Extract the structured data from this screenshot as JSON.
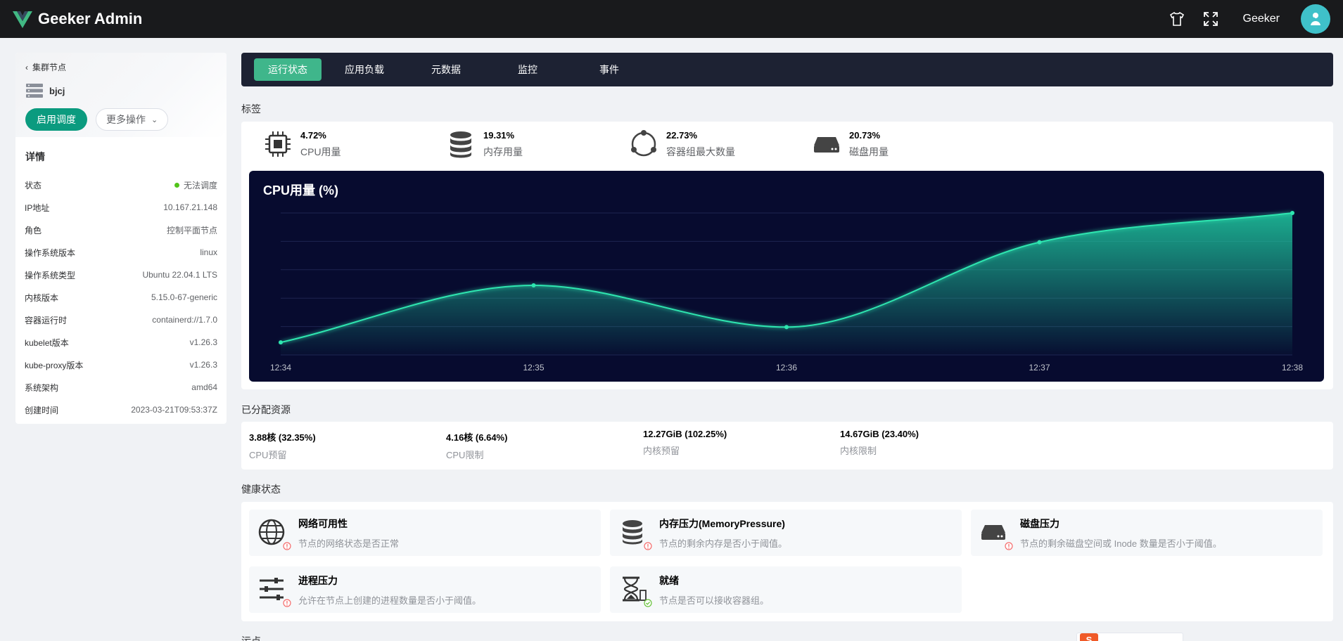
{
  "app": {
    "title": "Geeker Admin",
    "username": "Geeker"
  },
  "colors": {
    "primary": "#0b9b7f",
    "tab_active": "#3fb68b",
    "header_bg": "#191a1c",
    "tabs_bg": "#1d2233",
    "chart_bg": "#070b2f",
    "chart_line": "#2ee6b0"
  },
  "left": {
    "back_label": "集群节点",
    "node_name": "bjcj",
    "primary_button": "启用调度",
    "more_button": "更多操作",
    "details_title": "详情",
    "details": [
      {
        "key": "状态",
        "value": "无法调度",
        "status_dot": true
      },
      {
        "key": "IP地址",
        "value": "10.167.21.148"
      },
      {
        "key": "角色",
        "value": "控制平面节点"
      },
      {
        "key": "操作系统版本",
        "value": "linux"
      },
      {
        "key": "操作系统类型",
        "value": "Ubuntu 22.04.1 LTS"
      },
      {
        "key": "内核版本",
        "value": "5.15.0-67-generic"
      },
      {
        "key": "容器运行时",
        "value": "containerd://1.7.0"
      },
      {
        "key": "kubelet版本",
        "value": "v1.26.3"
      },
      {
        "key": "kube-proxy版本",
        "value": "v1.26.3"
      },
      {
        "key": "系统架构",
        "value": "amd64"
      },
      {
        "key": "创建时间",
        "value": "2023-03-21T09:53:37Z"
      }
    ]
  },
  "tabs": [
    {
      "label": "运行状态",
      "active": true
    },
    {
      "label": "应用负载"
    },
    {
      "label": "元数据"
    },
    {
      "label": "监控"
    },
    {
      "label": "事件"
    }
  ],
  "labels_section": {
    "title": "标签",
    "metrics": [
      {
        "value": "4.72%",
        "label": "CPU用量",
        "icon": "cpu-icon"
      },
      {
        "value": "19.31%",
        "label": "内存用量",
        "icon": "database-icon"
      },
      {
        "value": "22.73%",
        "label": "容器组最大数量",
        "icon": "pods-cycle-icon"
      },
      {
        "value": "20.73%",
        "label": "磁盘用量",
        "icon": "disk-icon"
      }
    ]
  },
  "chart_data": {
    "type": "area",
    "title": "CPU用量 (%)",
    "x": [
      "12:34",
      "12:35",
      "12:36",
      "12:37",
      "12:38"
    ],
    "series": [
      {
        "values": [
          0.9,
          5.0,
          2.0,
          8.1,
          10.2
        ]
      }
    ],
    "ylim": [
      0,
      10.2
    ],
    "grid": true
  },
  "allocated": {
    "title": "已分配资源",
    "items": [
      {
        "value": "3.88核 (32.35%)",
        "label": "CPU预留"
      },
      {
        "value": "4.16核 (6.64%)",
        "label": "CPU限制"
      },
      {
        "value": "12.27GiB (102.25%)",
        "label": "内核预留"
      },
      {
        "value": "14.67GiB (23.40%)",
        "label": "内核限制"
      }
    ]
  },
  "health": {
    "title": "健康状态",
    "items": [
      {
        "title": "网络可用性",
        "desc": "节点的网络状态是否正常",
        "icon": "globe-icon",
        "status": "warning"
      },
      {
        "title": "内存压力(MemoryPressure)",
        "desc": "节点的剩余内存是否小于阈值。",
        "icon": "database-icon",
        "status": "warning"
      },
      {
        "title": "磁盘压力",
        "desc": "节点的剩余磁盘空间或 Inode 数量是否小于阈值。",
        "icon": "disk-icon",
        "status": "warning"
      },
      {
        "title": "进程压力",
        "desc": "允许在节点上创建的进程数量是否小于阈值。",
        "icon": "sliders-icon",
        "status": "warning"
      },
      {
        "title": "就绪",
        "desc": "节点是否可以接收容器组。",
        "icon": "hourglass-icon",
        "status": "ok"
      }
    ]
  },
  "bottom": {
    "partial_title": "污点"
  }
}
